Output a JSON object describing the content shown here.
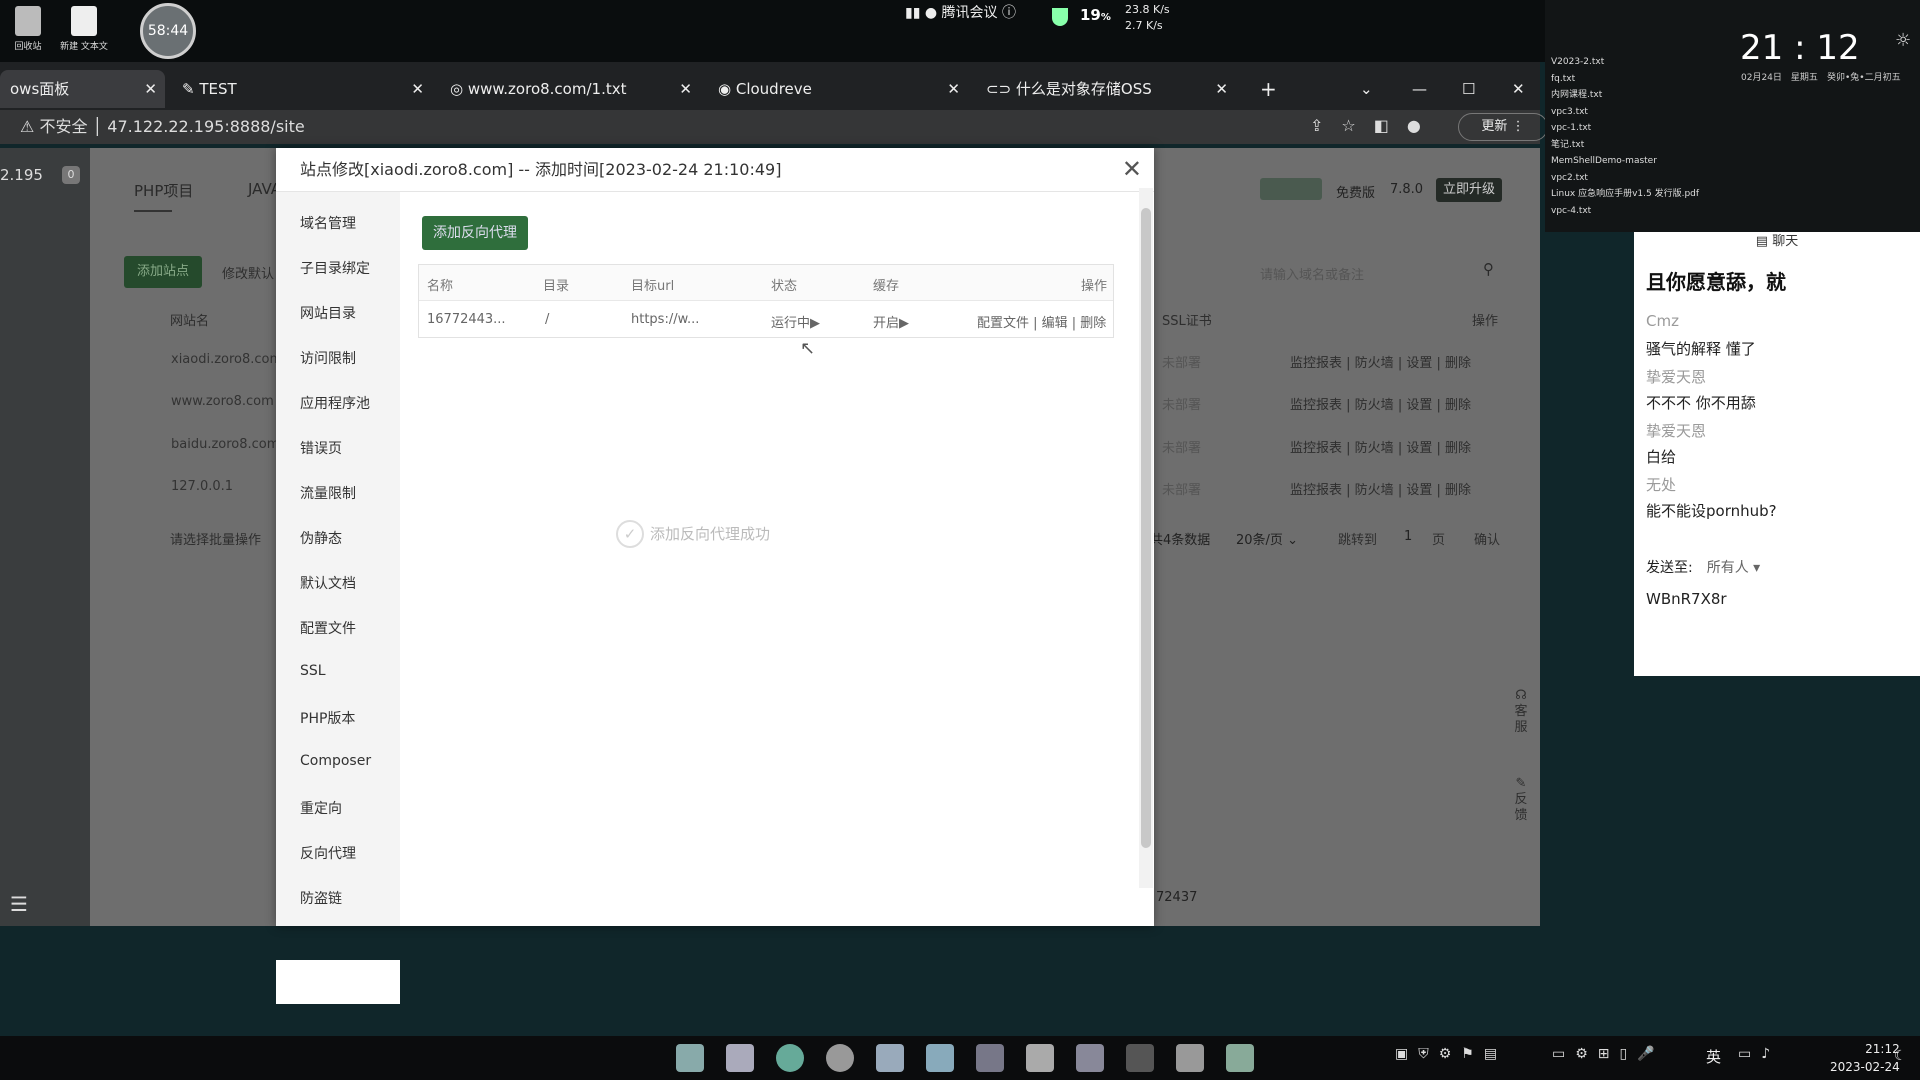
{
  "desktop": {
    "recycle_bin": "回收站",
    "new_text_doc": "新建 文本文",
    "timer": "58:44",
    "meeting": "腾讯会议",
    "cpu": "19",
    "cpu_unit": "%",
    "net_up": "23.8 K/s",
    "net_down": "2.7 K/s"
  },
  "browser": {
    "tabs": [
      {
        "label": "ows面板",
        "active": true
      },
      {
        "label": "TEST"
      },
      {
        "label": "www.zoro8.com/1.txt"
      },
      {
        "label": "Cloudreve"
      },
      {
        "label": "什么是对象存储OSS"
      }
    ],
    "insecure": "不安全",
    "url": "47.122.22.195:8888/site",
    "update": "更新"
  },
  "panel": {
    "ip_fragment": "2.195",
    "badge": "0",
    "tabs": [
      "PHP项目",
      "JAVA"
    ],
    "add_site": "添加站点",
    "edit_default": "修改默认",
    "col_site": "网站名",
    "sites": [
      "xiaodi.zoro8.com",
      "www.zoro8.com",
      "baidu.zoro8.com",
      "127.0.0.1"
    ],
    "batch": "请选择批量操作",
    "version_label": "免费版",
    "version": "7.8.0",
    "upgrade": "立即升级",
    "search_placeholder": "请输入域名或备注",
    "col_ssl": "SSL证书",
    "col_op": "操作",
    "ssl_status": "未部署",
    "ops": [
      "监控报表",
      "防火墙",
      "设置",
      "删除"
    ],
    "count": "共4条数据",
    "per_page": "20条/页",
    "jump_to": "跳转到",
    "page_num": "1",
    "page_unit": "页",
    "confirm": "确认",
    "footer_num": "72437",
    "support": "客服",
    "feedback": "反馈"
  },
  "modal": {
    "title": "站点修改[xiaodi.zoro8.com] -- 添加时间[2023-02-24 21:10:49]",
    "nav": [
      "域名管理",
      "子目录绑定",
      "网站目录",
      "访问限制",
      "应用程序池",
      "错误页",
      "流量限制",
      "伪静态",
      "默认文档",
      "配置文件",
      "SSL",
      "PHP版本",
      "Composer",
      "重定向",
      "反向代理",
      "防盗链"
    ],
    "active_nav": "反向代理",
    "add_proxy": "添加反向代理",
    "headers": [
      "名称",
      "目录",
      "目标url",
      "状态",
      "缓存",
      "操作"
    ],
    "row": {
      "name": "16772443...",
      "dir": "/",
      "url": "https://w...",
      "status": "运行中▶",
      "cache": "开启▶",
      "ops": "配置文件 | 编辑 | 删除"
    },
    "loading": "添加反向代理成功"
  },
  "side": {
    "files": [
      "V2023-2.txt",
      "fq.txt",
      "内网课程.txt",
      "vpc3.txt",
      "vpc-1.txt",
      "笔记.txt",
      "MemShellDemo-master",
      "vpc2.txt",
      "Linux 应急响应手册v1.5 发行版.pdf",
      "vpc-4.txt"
    ],
    "time": "21 : 12",
    "date": "02月24日",
    "weekday": "星期五",
    "lunar": "癸卯•兔•二月初五"
  },
  "chat": {
    "title": "聊天",
    "top_msg": "且你愿意舔，就",
    "messages": [
      {
        "nick": "Cmz",
        "text": "骚气的解释 懂了"
      },
      {
        "nick": "挚爱天恩",
        "text": "不不不 你不用舔"
      },
      {
        "nick": "挚爱天恩",
        "text": "白给"
      },
      {
        "nick": "无处",
        "text": "能不能设pornhub?"
      }
    ],
    "send_to": "发送至:",
    "recipient": "所有人",
    "input": "WBnR7X8r"
  },
  "taskbar": {
    "ime": "英",
    "time": "21:12",
    "date": "2023-02-24"
  }
}
